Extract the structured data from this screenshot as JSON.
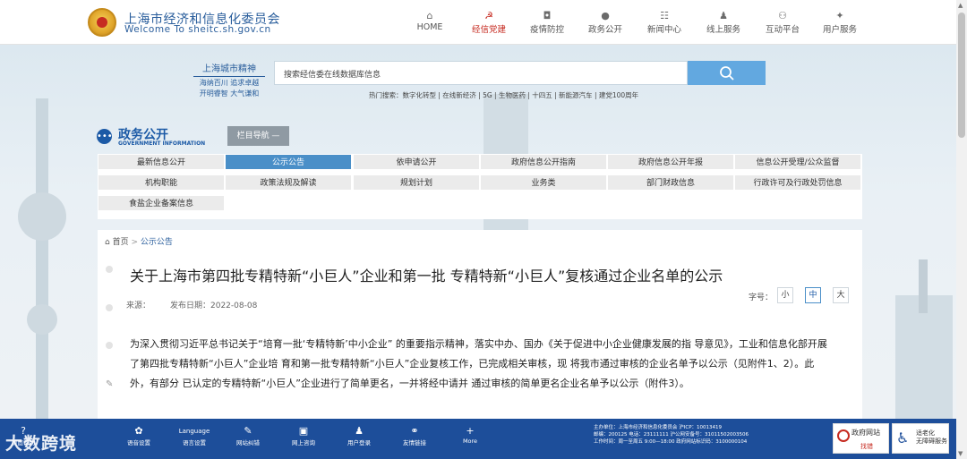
{
  "header": {
    "title": "上海市经济和信息化委员会",
    "subtitle": "Welcome To sheitc.sh.gov.cn",
    "nav": [
      {
        "label": "HOME",
        "icon": "home-icon",
        "glyph": "⌂"
      },
      {
        "label": "经信党建",
        "icon": "party-emblem-icon",
        "glyph": "☭"
      },
      {
        "label": "疫情防控",
        "icon": "shield-icon",
        "glyph": "◘"
      },
      {
        "label": "政务公开",
        "icon": "chat-icon",
        "glyph": "●"
      },
      {
        "label": "新闻中心",
        "icon": "news-icon",
        "glyph": "☷"
      },
      {
        "label": "线上服务",
        "icon": "person-service-icon",
        "glyph": "♟"
      },
      {
        "label": "互动平台",
        "icon": "interact-icon",
        "glyph": "⚇"
      },
      {
        "label": "用户服务",
        "icon": "user-icon",
        "glyph": "✦"
      }
    ],
    "active_nav": 1
  },
  "spirit": {
    "title": "上海城市精神",
    "line1": "海纳百川 追求卓越",
    "line2": "开明睿智 大气谦和"
  },
  "search": {
    "placeholder": "搜索经信委在线数据库信息",
    "hot": "热门搜索：数字化转型 | 在线新经济 | 5G | 生物医药 | 十四五 | 新能源汽车 | 建党100周年"
  },
  "section": {
    "title": "政务公开",
    "subtitle": "GOVERNMENT INFORMATION",
    "colnav": "栏目导航 —"
  },
  "tabs": [
    "最新信息公开",
    "公示公告",
    "依申请公开",
    "政府信息公开指南",
    "政府信息公开年报",
    "信息公开受理/公众监督",
    "机构职能",
    "政策法规及解读",
    "规划计划",
    "业务类",
    "部门财政信息",
    "行政许可及行政处罚信息",
    "食盐企业备案信息"
  ],
  "active_tab": 1,
  "breadcrumb": {
    "home": "首页",
    "sep": ">",
    "current": "公示公告"
  },
  "article": {
    "title": "关于上海市第四批专精特新“小巨人”企业和第一批 专精特新“小巨人”复核通过企业名单的公示",
    "source": "来源：",
    "date": "发布日期：2022-08-08",
    "fontsize_label": "字号：",
    "fontsizes": [
      "小",
      "中",
      "大"
    ],
    "active_fontsize": 1,
    "body": "为深入贯彻习近平总书记关于“培育一批‘专精特新’中小企业” 的重要指示精神，落实中办、国办《关于促进中小企业健康发展的指 导意见》，工业和信息化部开展了第四批专精特新“小巨人”企业培 育和第一批专精特新“小巨人”企业复核工作，已完成相关审核，现 将我市通过审核的企业名单予以公示（见附件1、2）。此外，有部分 已认定的专精特新“小巨人”企业进行了简单更名，一并将经中请并 通过审核的简单更名企业名单予以公示（附件3）。"
  },
  "footer": {
    "buttons": [
      {
        "label": "页面帮助",
        "icon": "help-icon",
        "glyph": "?"
      },
      {
        "label": "语音设置",
        "icon": "settings-icon",
        "glyph": "✿"
      },
      {
        "label": "语言设置",
        "icon": "language-icon",
        "glyph": "Language"
      },
      {
        "label": "网站纠错",
        "icon": "wrench-icon",
        "glyph": "✎"
      },
      {
        "label": "网上咨询",
        "icon": "consult-icon",
        "glyph": "▣"
      },
      {
        "label": "用户登录",
        "icon": "login-icon",
        "glyph": "♟"
      },
      {
        "label": "友情链接",
        "icon": "link-icon",
        "glyph": "⚭"
      },
      {
        "label": "More",
        "icon": "plus-icon",
        "glyph": "+"
      }
    ],
    "info_lines": [
      "主办单位：上海市经济和信息化委员会  沪ICP：10013419",
      "邮编：200125  电话：23111111  沪公网安备号：31011502003506",
      "工作时间：周一至周五 9:00—18:00  政府网站标识码：3100000104"
    ],
    "gov_site": {
      "title": "政府网站",
      "sub": "找错"
    },
    "accessible": {
      "line1": "适老化",
      "line2": "无障碍服务"
    },
    "watermark": "大数跨境"
  },
  "colors": {
    "brand": "#1c5aa6",
    "accent": "#c62b21",
    "footer": "#1d4e9a",
    "active_tab": "#4a8fc8"
  }
}
